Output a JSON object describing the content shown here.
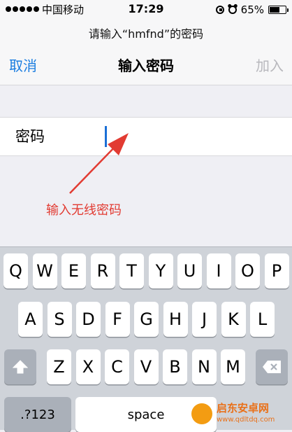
{
  "status_bar": {
    "carrier": "中国移动",
    "time": "17:29",
    "battery_percent_label": "65%",
    "battery_level": 0.65,
    "icons": [
      "signal-dots-icon",
      "rotation-lock-icon",
      "alarm-icon",
      "battery-icon"
    ]
  },
  "nav": {
    "prompt": "请输入“hmfnd”的密码",
    "cancel_label": "取消",
    "title": "输入密码",
    "join_label": "加入"
  },
  "password": {
    "label": "密码",
    "value": ""
  },
  "annotation": {
    "text": "输入无线密码",
    "color": "#e23b32"
  },
  "keyboard": {
    "row1": [
      "Q",
      "W",
      "E",
      "R",
      "T",
      "Y",
      "U",
      "I",
      "O",
      "P"
    ],
    "row2": [
      "A",
      "S",
      "D",
      "F",
      "G",
      "H",
      "J",
      "K",
      "L"
    ],
    "row3": [
      "Z",
      "X",
      "C",
      "V",
      "B",
      "N",
      "M"
    ],
    "numbers_label": ".?123",
    "space_label": "space"
  },
  "watermark": {
    "title": "启东安卓网",
    "url": "www.qdltdq.com"
  },
  "colors": {
    "accent": "#1a7de0",
    "disabled": "#b8b8bd",
    "keyboard_bg": "#cfd3d9"
  }
}
